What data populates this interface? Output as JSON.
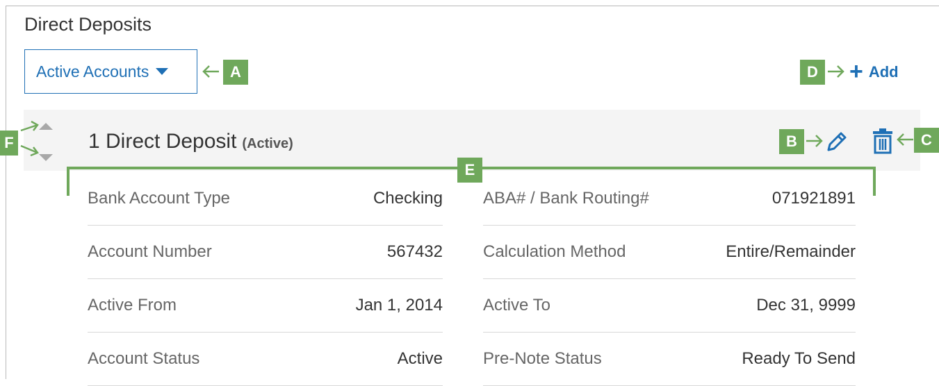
{
  "header": {
    "title": "Direct Deposits"
  },
  "filter": {
    "selected": "Active Accounts"
  },
  "toolbar": {
    "add_label": "Add"
  },
  "record": {
    "title": "1 Direct Deposit",
    "status": "(Active)"
  },
  "details": {
    "left": [
      {
        "label": "Bank Account Type",
        "value": "Checking"
      },
      {
        "label": "Account Number",
        "value": "567432"
      },
      {
        "label": "Active From",
        "value": "Jan 1, 2014"
      },
      {
        "label": "Account Status",
        "value": "Active"
      }
    ],
    "right": [
      {
        "label": "ABA# / Bank Routing#",
        "value": "071921891"
      },
      {
        "label": "Calculation Method",
        "value": "Entire/Remainder"
      },
      {
        "label": "Active To",
        "value": "Dec 31, 9999"
      },
      {
        "label": "Pre-Note Status",
        "value": "Ready To Send"
      }
    ]
  },
  "callouts": {
    "a": "A",
    "b": "B",
    "c": "C",
    "d": "D",
    "e": "E",
    "f": "F"
  },
  "icons": [
    "caret-down-icon",
    "plus-icon",
    "pencil-icon",
    "trash-icon",
    "sort-up-icon",
    "sort-down-icon"
  ],
  "colors": {
    "accent": "#1e6fb5",
    "callout": "#6fa85b",
    "header_bg": "#f4f4f4"
  }
}
